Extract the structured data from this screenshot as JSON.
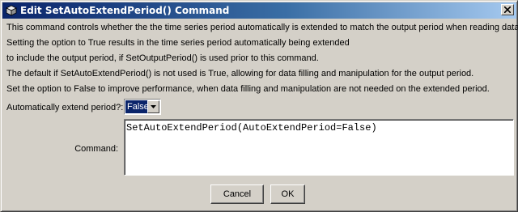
{
  "window": {
    "title": "Edit SetAutoExtendPeriod() Command",
    "icon": "app-cube-icon",
    "close_icon": "close-icon"
  },
  "info": {
    "line1": "This command controls whether the the time series period automatically is extended to match the output period when reading data.",
    "line2": "Setting the option to True results in the time series period automatically being extended",
    "line3": "to include the output period, if SetOutputPeriod() is used prior to this command.",
    "line4": "The default if SetAutoExtendPeriod() is not used is True, allowing for data filling and manipulation for the output period.",
    "line5": "Set the option to False to improve performance, when data filling and manipulation are not needed on the extended period."
  },
  "form": {
    "auto_extend_label": "Automatically extend period?:",
    "auto_extend_value": "False",
    "command_label": "Command:",
    "command_text": "SetAutoExtendPeriod(AutoExtendPeriod=False)"
  },
  "buttons": {
    "cancel": "Cancel",
    "ok": "OK"
  },
  "colors": {
    "title_bar_start": "#0a246a",
    "title_bar_end": "#a6caf0",
    "dialog_background": "#d4d0c8",
    "selection": "#0a246a"
  }
}
